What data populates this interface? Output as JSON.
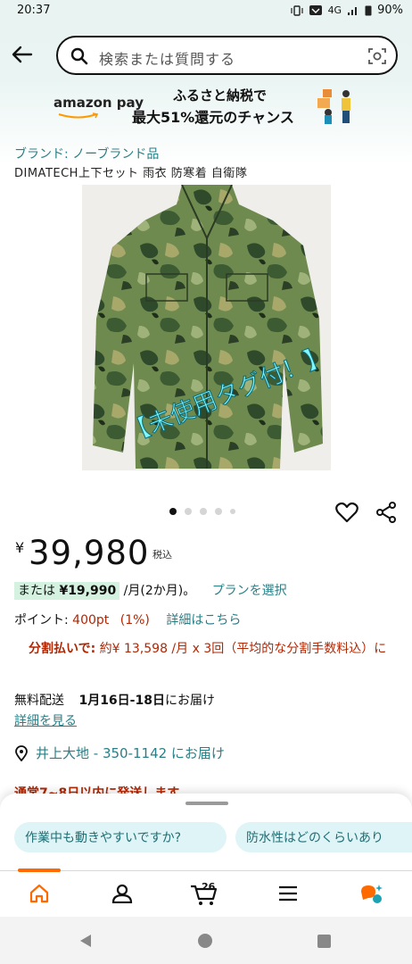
{
  "status_bar": {
    "time": "20:37",
    "network": "4G",
    "battery": "90%"
  },
  "search": {
    "placeholder": "検索または質問する"
  },
  "banner": {
    "pay_label": "amazon pay",
    "line1": "ふるさと納税で",
    "line2": "最大51%還元のチャンス"
  },
  "product": {
    "brand": "ブランド: ノーブランド品",
    "title": "DIMATECH上下セット 雨衣 防寒着 自衛隊",
    "image_caption": "【未使用タグ付！】",
    "image_count": 5,
    "image_index": 1
  },
  "price": {
    "currency": "¥",
    "amount": "39,980",
    "tax_label": "税込",
    "alt_prefix": "または",
    "alt_amount": "¥19,990",
    "alt_suffix": "/月(2か月)。",
    "plan_link": "プランを選択"
  },
  "points": {
    "label": "ポイント:",
    "value": "400pt",
    "percent": "(1%)",
    "link": "詳細はこちら"
  },
  "installment": {
    "lead": "分割払いで:",
    "text": "約¥ 13,598 /月 x 3回（平均的な分割手数料込）に"
  },
  "shipping": {
    "prefix": "無料配送",
    "dates": "1月16日-18日",
    "suffix": "にお届け",
    "detail_link": "詳細を見る"
  },
  "delivery_address": "井上大地 - 350-1142 にお届け",
  "cutoff_notice": "通常7~8日以内に発送します",
  "suggestions": [
    "作業中も動きやすいですか?",
    "防水性はどのくらいあり"
  ],
  "bottom_nav": {
    "items": [
      "home",
      "account",
      "cart",
      "menu",
      "rufus"
    ],
    "cart_count": "26",
    "accent_color": "#ff6a00"
  },
  "colors": {
    "link": "#2a7f86",
    "price_red": "#b12704",
    "highlight": "#d4f2df",
    "chip_bg": "#dff4f6"
  }
}
